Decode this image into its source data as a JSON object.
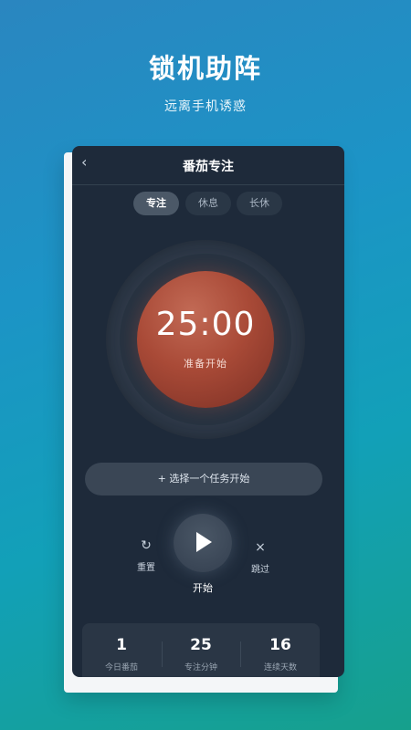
{
  "hero": {
    "title": "锁机助阵",
    "subtitle": "远离手机诱惑"
  },
  "nav": {
    "back_icon": "‹",
    "title": "番茄专注"
  },
  "tabs": [
    {
      "label": "专注",
      "selected": true
    },
    {
      "label": "休息",
      "selected": false
    },
    {
      "label": "长休",
      "selected": false
    }
  ],
  "timer": {
    "display": "25:00",
    "status": "准备开始"
  },
  "task_button": {
    "label": "+ 选择一个任务开始"
  },
  "controls": {
    "reset_icon": "↻",
    "reset_label": "重置",
    "play_label": "开始",
    "skip_icon": "×",
    "skip_label": "跳过"
  },
  "stats": [
    {
      "value": "1",
      "label": "今日番茄"
    },
    {
      "value": "25",
      "label": "专注分钟"
    },
    {
      "value": "16",
      "label": "连续天数"
    }
  ],
  "colors": {
    "background_start": "#2a86c0",
    "background_end": "#16a08c",
    "panel": "#1e2a3a",
    "tomato": "#a94a37"
  }
}
